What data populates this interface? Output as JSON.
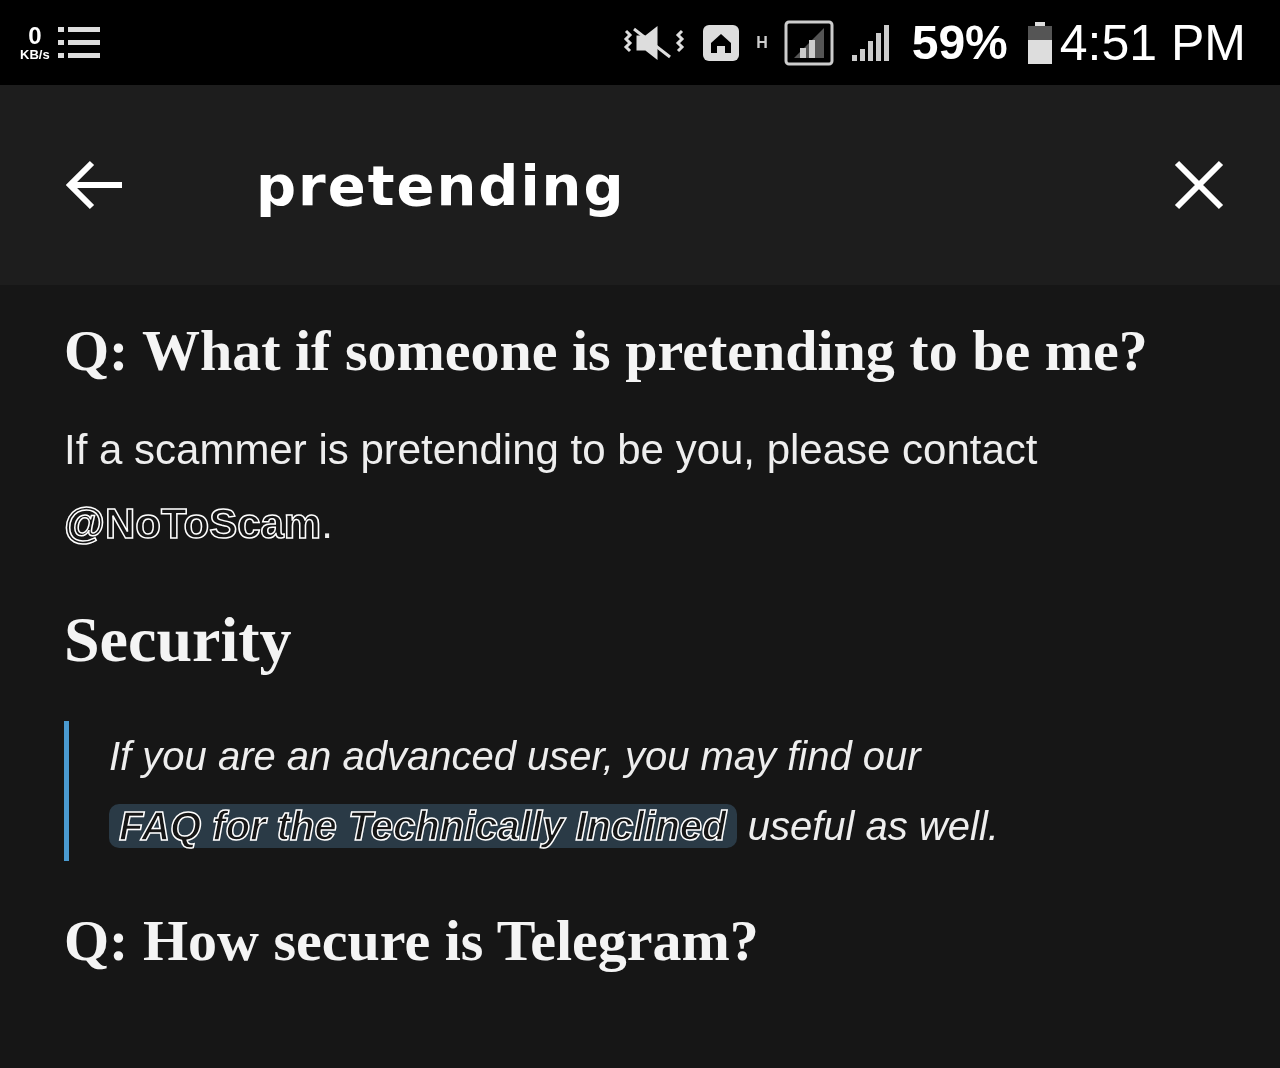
{
  "status_bar": {
    "speed_value": "0",
    "speed_unit": "KB/s",
    "network_type": "H",
    "battery": "59%",
    "time": "4:51 PM"
  },
  "search": {
    "query": "pretending"
  },
  "content": [
    {
      "kind": "question",
      "text": "Q: What if someone is pretending to be me?"
    },
    {
      "kind": "paragraph",
      "text_before": "If a scammer is pretending to be you, please contact ",
      "link": "@NoToScam",
      "text_after": "."
    },
    {
      "kind": "section",
      "text": "Security"
    },
    {
      "kind": "quote",
      "text_before": "If you are an advanced user, you may find our ",
      "link": "FAQ for the Technically Inclined",
      "text_after": " useful as well."
    },
    {
      "kind": "question",
      "text": "Q: How secure is Telegram?"
    }
  ]
}
